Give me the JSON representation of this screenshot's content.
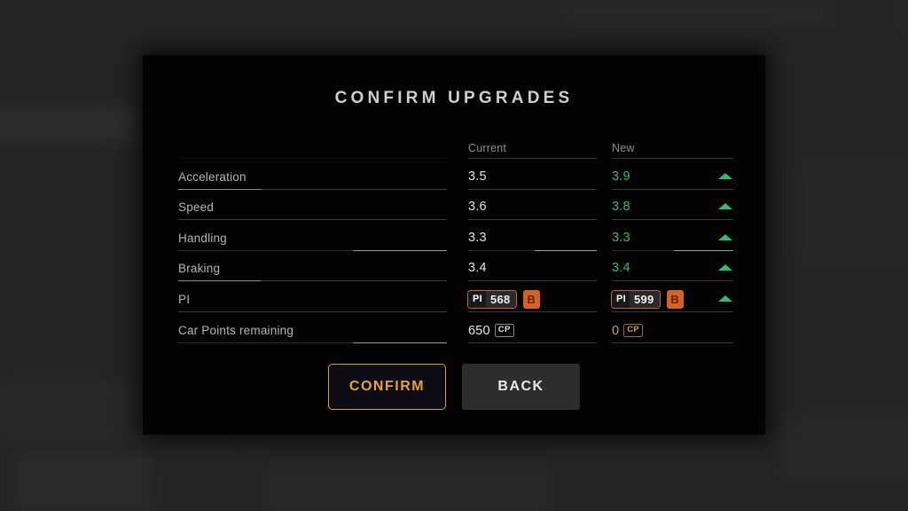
{
  "dialog": {
    "title": "CONFIRM UPGRADES"
  },
  "table": {
    "headers": {
      "label": "",
      "current": "Current",
      "new": "New"
    },
    "rows": [
      {
        "label": "Acceleration",
        "current": "3.5",
        "new": "3.9",
        "arrow": "arrow-up-icon",
        "improved": true
      },
      {
        "label": "Speed",
        "current": "3.6",
        "new": "3.8",
        "arrow": "arrow-up-icon",
        "improved": true
      },
      {
        "label": "Handling",
        "current": "3.3",
        "new": "3.3",
        "arrow": "arrow-up-icon",
        "improved": true
      },
      {
        "label": "Braking",
        "current": "3.4",
        "new": "3.4",
        "arrow": "arrow-up-icon",
        "improved": true
      }
    ],
    "pi_row": {
      "label": "PI",
      "current": {
        "tag": "PI",
        "value": "568",
        "class": "B"
      },
      "new": {
        "tag": "PI",
        "value": "599",
        "class": "B"
      },
      "arrow": "arrow-up-icon"
    },
    "cp_row": {
      "label": "Car Points remaining",
      "current": {
        "value": "650",
        "unit": "CP"
      },
      "new": {
        "value": "0",
        "unit": "CP"
      }
    }
  },
  "buttons": {
    "confirm": "CONFIRM",
    "back": "BACK"
  },
  "colors": {
    "accent_orange": "#e09a35",
    "improved_green": "#2fbd72",
    "class_badge_orange": "#d4631f",
    "gold": "#c6a24c",
    "modal_bg": "#030303",
    "page_bg": "#252525"
  }
}
